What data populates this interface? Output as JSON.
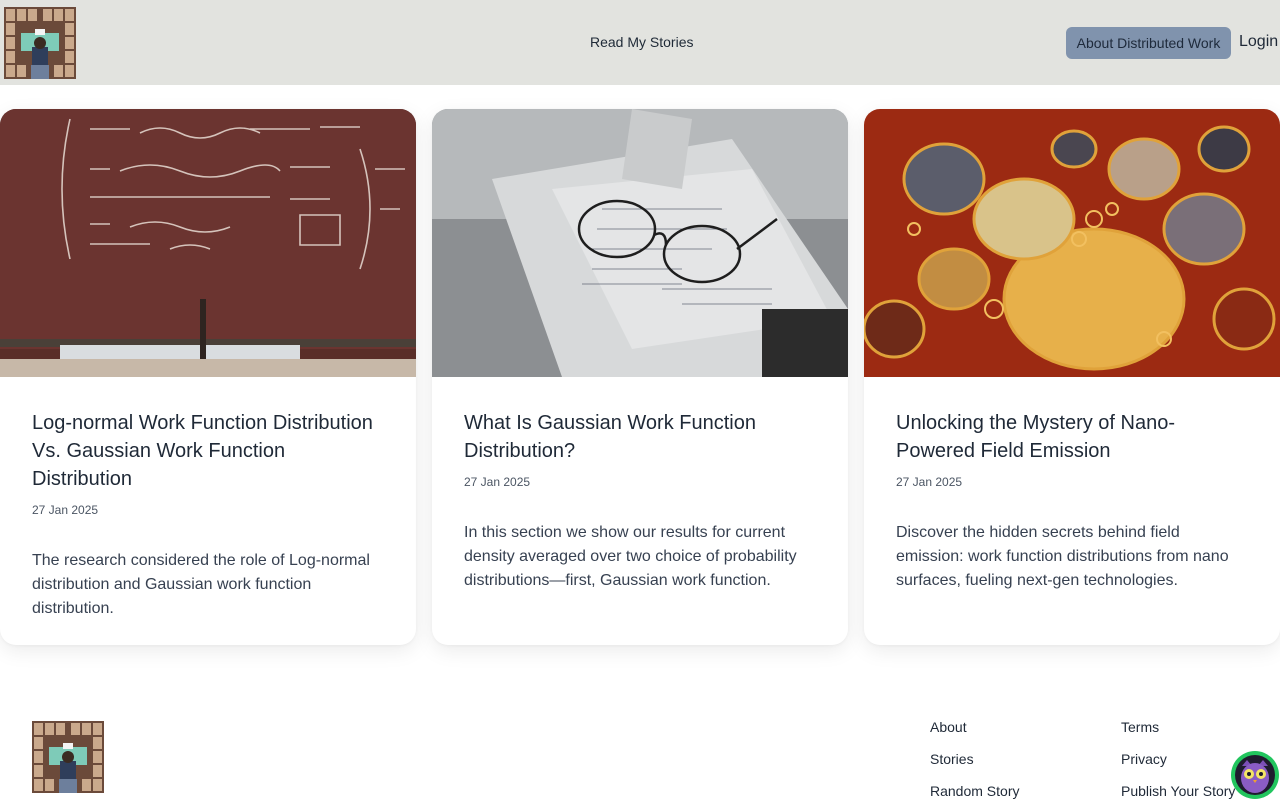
{
  "header": {
    "logo_alt": "logo",
    "nav_stories": "Read My Stories",
    "about_button": "About Distributed Work",
    "login": "Login"
  },
  "cards": [
    {
      "image": "chalkboard-equations-image",
      "title": "Log-normal Work Function Distribution Vs. Gaussian Work Function Distribution",
      "date": "27 Jan 2025",
      "description": "The research considered the role of Log-normal distribution and Gaussian work function distribution."
    },
    {
      "image": "glasses-on-notebook-image",
      "title": "What Is Gaussian Work Function Distribution?",
      "date": "27 Jan 2025",
      "description": "In this section we show our results for current density averaged over two choice of probability distributions—first, Gaussian work function."
    },
    {
      "image": "oil-bubbles-macro-image",
      "title": "Unlocking the Mystery of Nano-Powered Field Emission",
      "date": "27 Jan 2025",
      "description": "Discover the hidden secrets behind field emission: work function distributions from nano surfaces, fueling next-gen technologies."
    }
  ],
  "footer": {
    "col1": [
      "About",
      "Stories",
      "Random Story"
    ],
    "col2": [
      "Terms",
      "Privacy",
      "Publish Your Story"
    ]
  },
  "colors": {
    "header_bg": "#e2e3df",
    "about_button_bg": "#8093ad",
    "owl_ring": "#22c55e"
  }
}
